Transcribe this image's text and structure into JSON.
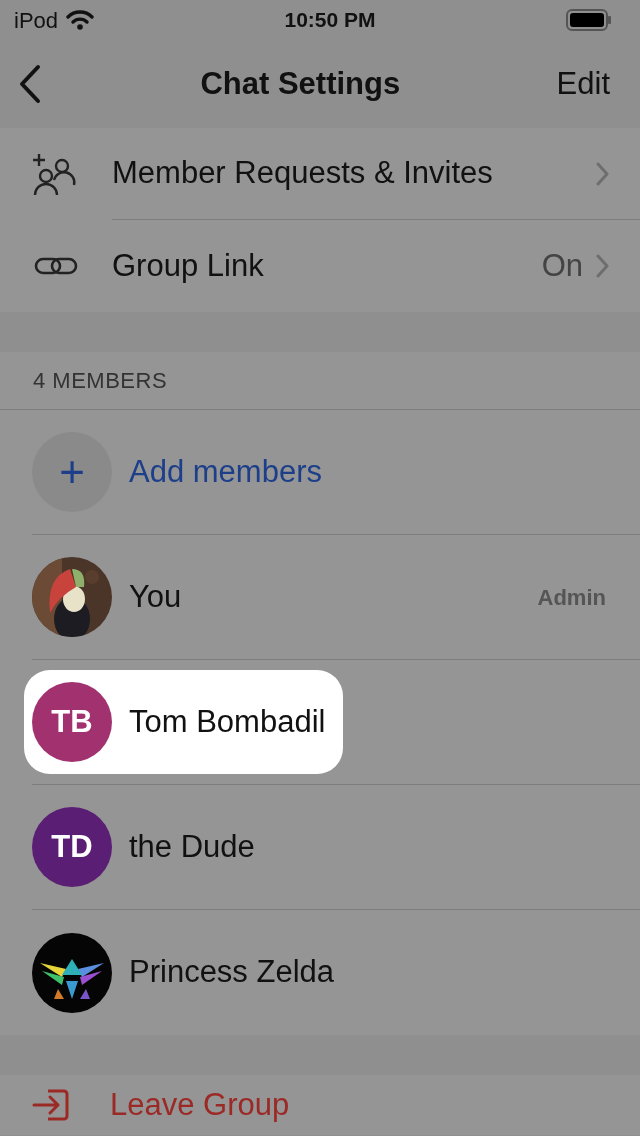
{
  "status_bar": {
    "carrier": "iPod",
    "time": "10:50 PM"
  },
  "nav": {
    "title": "Chat Settings",
    "action": "Edit"
  },
  "settings": [
    {
      "label": "Member Requests & Invites",
      "kind": "requests"
    },
    {
      "label": "Group Link",
      "value": "On",
      "kind": "link"
    }
  ],
  "members_header": "4 MEMBERS",
  "add_members": {
    "label": "Add members",
    "icon": "+"
  },
  "members": [
    {
      "name": "You",
      "role": "Admin",
      "selected": false
    },
    {
      "name": "Tom Bombadil",
      "avatar": {
        "kind": "initials",
        "initials": "TB",
        "color": "#a1326f"
      },
      "selected": true
    },
    {
      "name": "the Dude",
      "avatar": {
        "kind": "initials",
        "initials": "TD",
        "color": "#5a1f74"
      },
      "selected": false
    },
    {
      "name": "Princess Zelda",
      "selected": false
    }
  ],
  "leave": {
    "label": "Leave Group"
  }
}
